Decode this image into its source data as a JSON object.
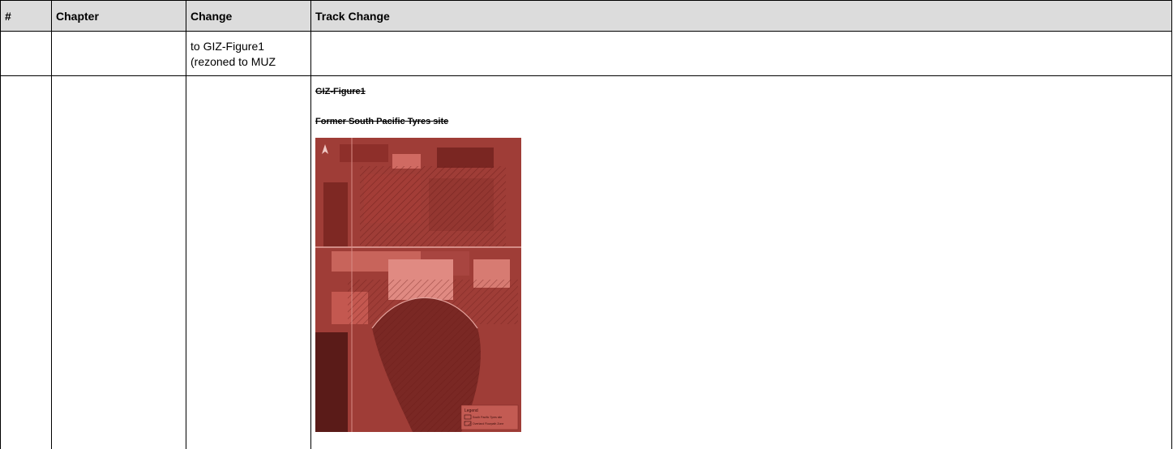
{
  "table": {
    "headers": [
      "#",
      "Chapter",
      "Change",
      "Track Change"
    ],
    "row1": {
      "number": "",
      "chapter": "",
      "change_line1": "to GIZ-Figure1",
      "change_line2": "(rezoned to MUZ",
      "track_change": ""
    },
    "row2": {
      "number": "",
      "chapter": "",
      "change": "",
      "figure_title": "GIZ-Figure1",
      "figure_subtitle": "Former South Pacific Tyres site",
      "map_legend_title": "Legend",
      "map_legend_item1": "South Pacific Tyres site",
      "map_legend_item2": "Overland Flowpath Zone"
    }
  },
  "colors": {
    "header_bg": "#dcdcdc",
    "map_tint": "#b5463f"
  }
}
